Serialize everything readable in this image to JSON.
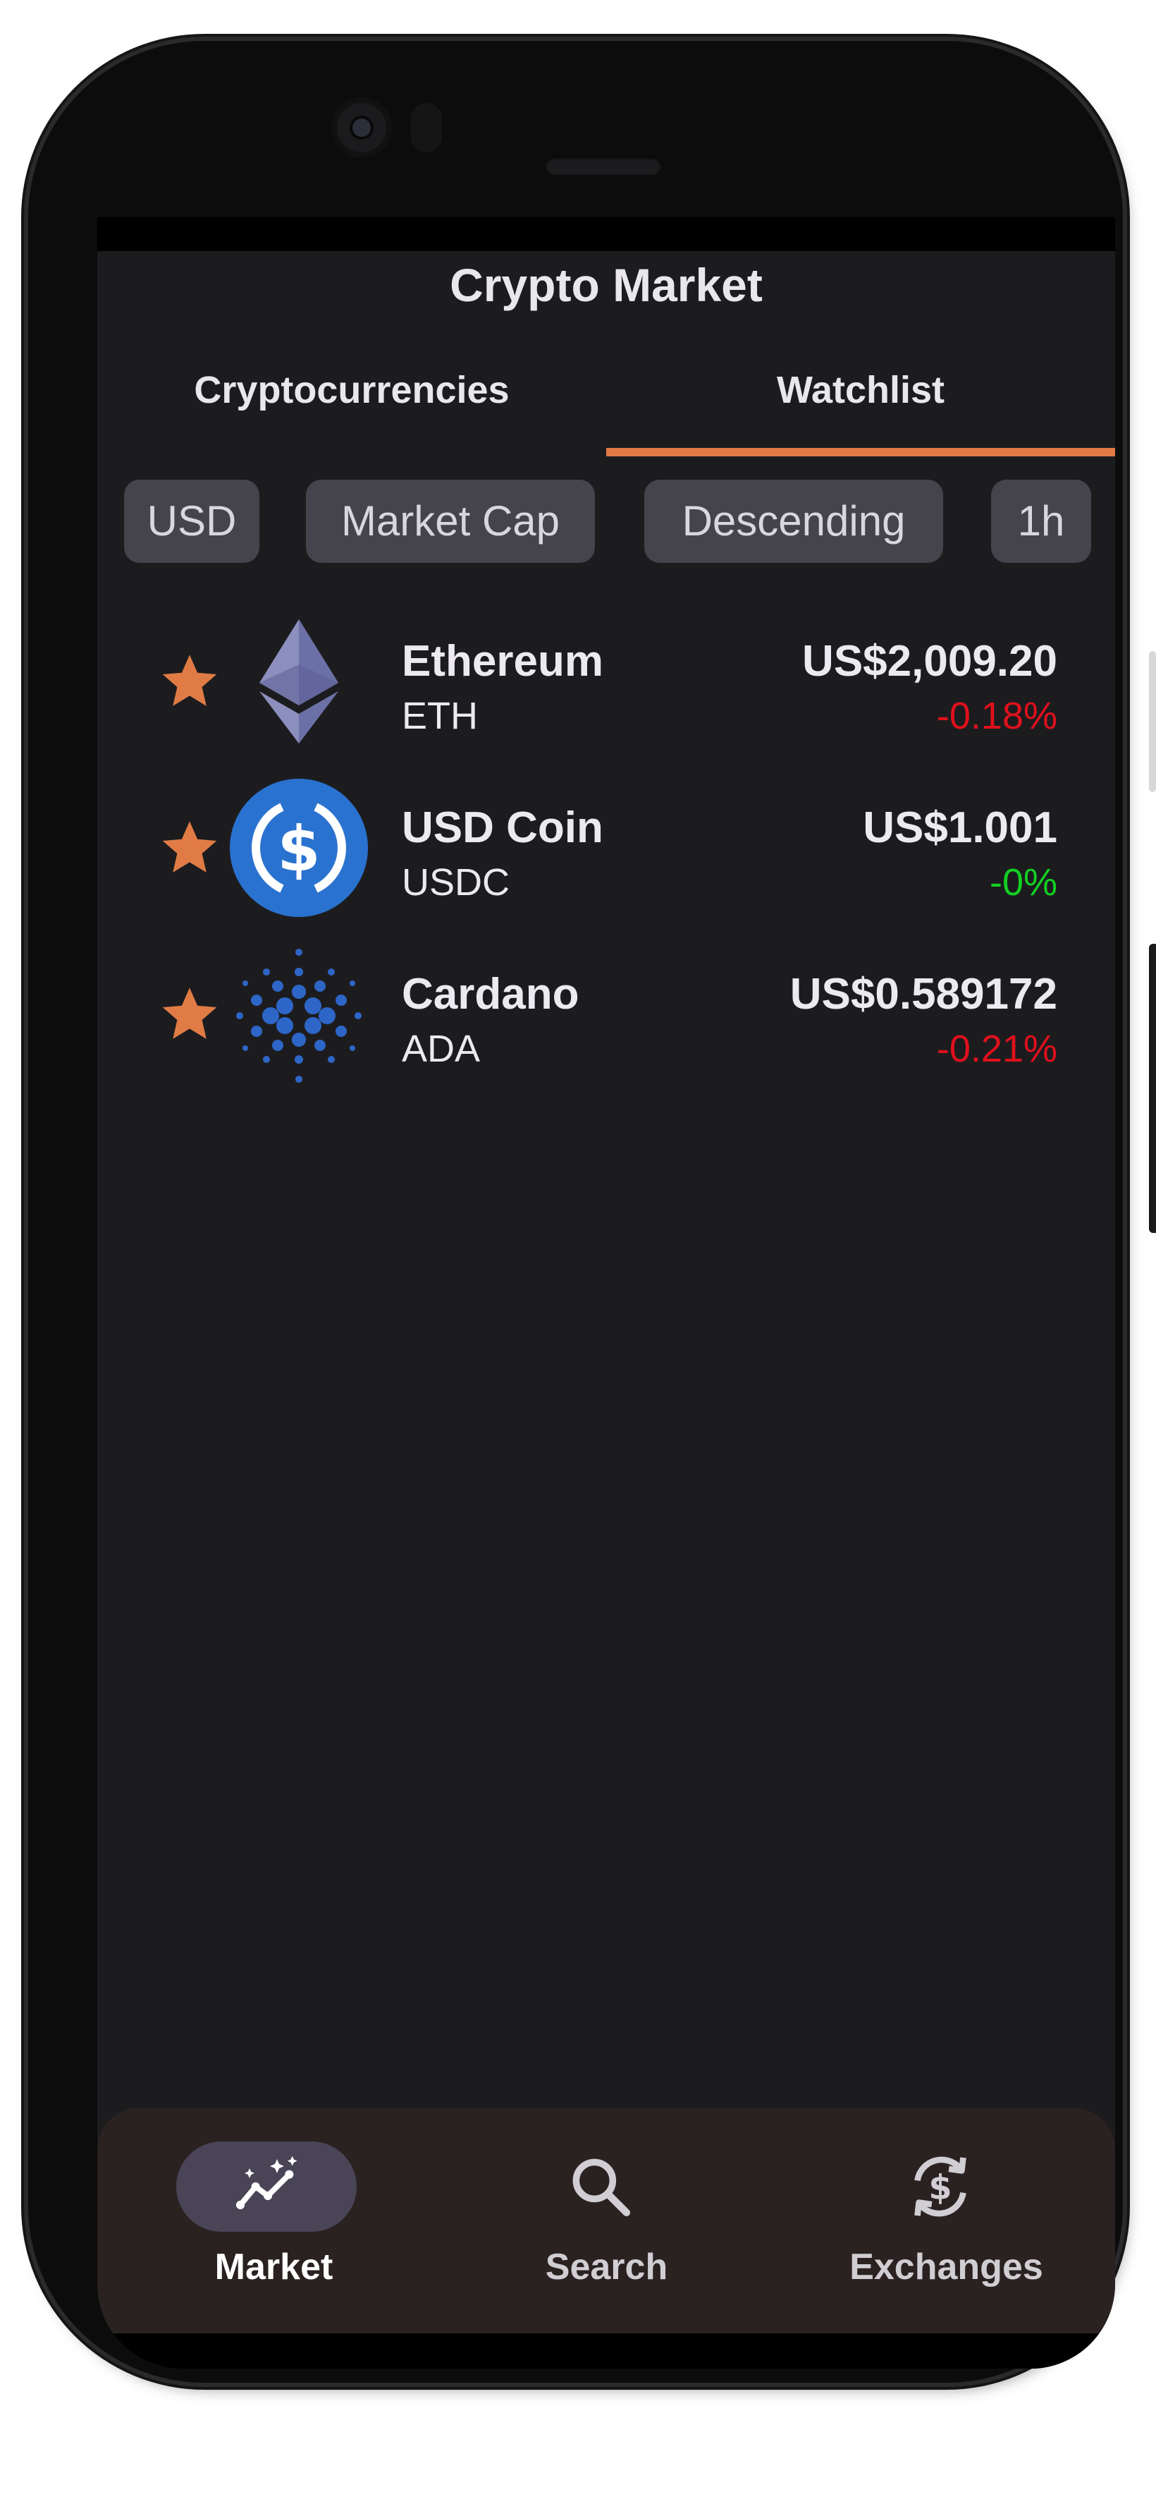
{
  "app": {
    "title": "Crypto Market"
  },
  "tabs": [
    {
      "label": "Cryptocurrencies",
      "selected": false
    },
    {
      "label": "Watchlist",
      "selected": true
    }
  ],
  "filters": {
    "currency": "USD",
    "sort_by": "Market Cap",
    "order": "Descending",
    "interval": "1h"
  },
  "coins": [
    {
      "name": "Ethereum",
      "symbol": "ETH",
      "price": "US$2,009.20",
      "change": "-0.18%",
      "trend": "negative",
      "icon": "ethereum-logo-icon",
      "starred": true
    },
    {
      "name": "USD Coin",
      "symbol": "USDC",
      "price": "US$1.001",
      "change": "-0%",
      "trend": "positive",
      "icon": "usd-coin-logo-icon",
      "starred": true
    },
    {
      "name": "Cardano",
      "symbol": "ADA",
      "price": "US$0.589172",
      "change": "-0.21%",
      "trend": "negative",
      "icon": "cardano-logo-icon",
      "starred": true
    }
  ],
  "bottom_nav": {
    "items": [
      {
        "label": "Market",
        "icon": "market-trend-icon",
        "selected": true
      },
      {
        "label": "Search",
        "icon": "search-icon",
        "selected": false
      },
      {
        "label": "Exchanges",
        "icon": "currency-exchange-icon",
        "selected": false
      }
    ]
  },
  "colors": {
    "accent": "#e07b45",
    "background": "#1c1c1f",
    "negative": "#e0101c",
    "positive": "#12d022",
    "chip": "#45434b",
    "nav_background": "#2a2221",
    "nav_pill": "#4a4457"
  }
}
